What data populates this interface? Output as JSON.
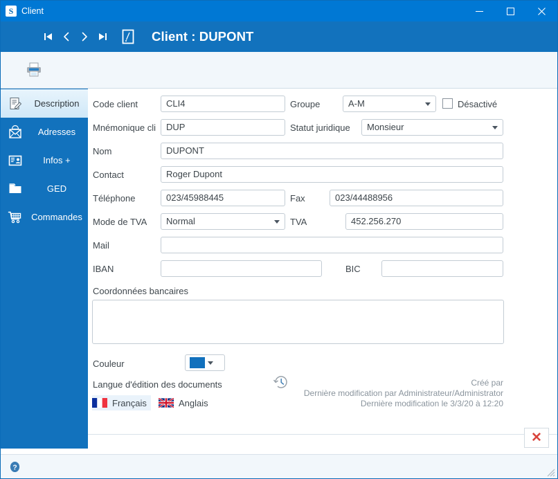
{
  "window": {
    "app_icon": "s-logo-icon",
    "title": "Client",
    "minimize_label": "—",
    "maximize_label": "□",
    "close_label": "✕"
  },
  "header": {
    "title": "Client : DUPONT",
    "nav": [
      {
        "name": "first-record",
        "icon": "skip-to-start-icon"
      },
      {
        "name": "previous-record",
        "icon": "chevron-left-icon"
      },
      {
        "name": "next-record",
        "icon": "chevron-right-icon"
      },
      {
        "name": "last-record",
        "icon": "skip-to-end-icon"
      }
    ],
    "new_record_icon": "new-record-icon"
  },
  "toolbar": {
    "print_icon": "print-icon"
  },
  "sidebar": {
    "items": [
      {
        "label": "Description",
        "icon": "document-edit-icon",
        "active": true
      },
      {
        "label": "Adresses",
        "icon": "envelope-icon",
        "active": false
      },
      {
        "label": "Infos +",
        "icon": "id-card-icon",
        "active": false
      },
      {
        "label": "GED",
        "icon": "folder-icon",
        "active": false
      },
      {
        "label": "Commandes",
        "icon": "shopping-cart-icon",
        "active": false
      }
    ]
  },
  "form": {
    "code_client": {
      "label": "Code client",
      "value": "CLI4"
    },
    "groupe": {
      "label": "Groupe",
      "value": "A-M"
    },
    "desactive": {
      "label": "Désactivé",
      "checked": false
    },
    "mnemonique": {
      "label": "Mnémonique cli",
      "value": "DUP"
    },
    "statut_juridique": {
      "label": "Statut juridique",
      "value": "Monsieur"
    },
    "nom": {
      "label": "Nom",
      "value": "DUPONT"
    },
    "contact": {
      "label": "Contact",
      "value": "Roger Dupont"
    },
    "telephone": {
      "label": "Téléphone",
      "value": "023/45988445"
    },
    "fax": {
      "label": "Fax",
      "value": "023/44488956"
    },
    "mode_tva": {
      "label": "Mode de TVA",
      "value": "Normal"
    },
    "tva": {
      "label": "TVA",
      "value": "452.256.270"
    },
    "mail": {
      "label": "Mail",
      "value": ""
    },
    "iban": {
      "label": "IBAN",
      "value": ""
    },
    "bic": {
      "label": "BIC",
      "value": ""
    },
    "coordonnees_bancaires": {
      "label": "Coordonnées bancaires",
      "value": ""
    },
    "couleur": {
      "label": "Couleur",
      "color": "#1271bd"
    },
    "langue": {
      "label": "Langue d'édition des documents",
      "options": [
        {
          "label": "Français",
          "flag": "flag-france-icon",
          "selected": true
        },
        {
          "label": "Anglais",
          "flag": "flag-uk-icon",
          "selected": false
        }
      ]
    }
  },
  "metadata": {
    "history_icon": "history-clock-icon",
    "line1": "Créé par",
    "line2": "Dernière modification par Administrateur/Administrator",
    "line3": "Dernière modification le 3/3/20 à 12:20"
  },
  "footer": {
    "close_label": "✕",
    "help_icon": "help-icon",
    "resize_grip_icon": "resize-grip-icon"
  },
  "colors": {
    "title_bar": "#0078d4",
    "header": "#1272bd",
    "sidebar": "#1272bd",
    "accent": "#1271bd",
    "close_red": "#d9453d"
  }
}
